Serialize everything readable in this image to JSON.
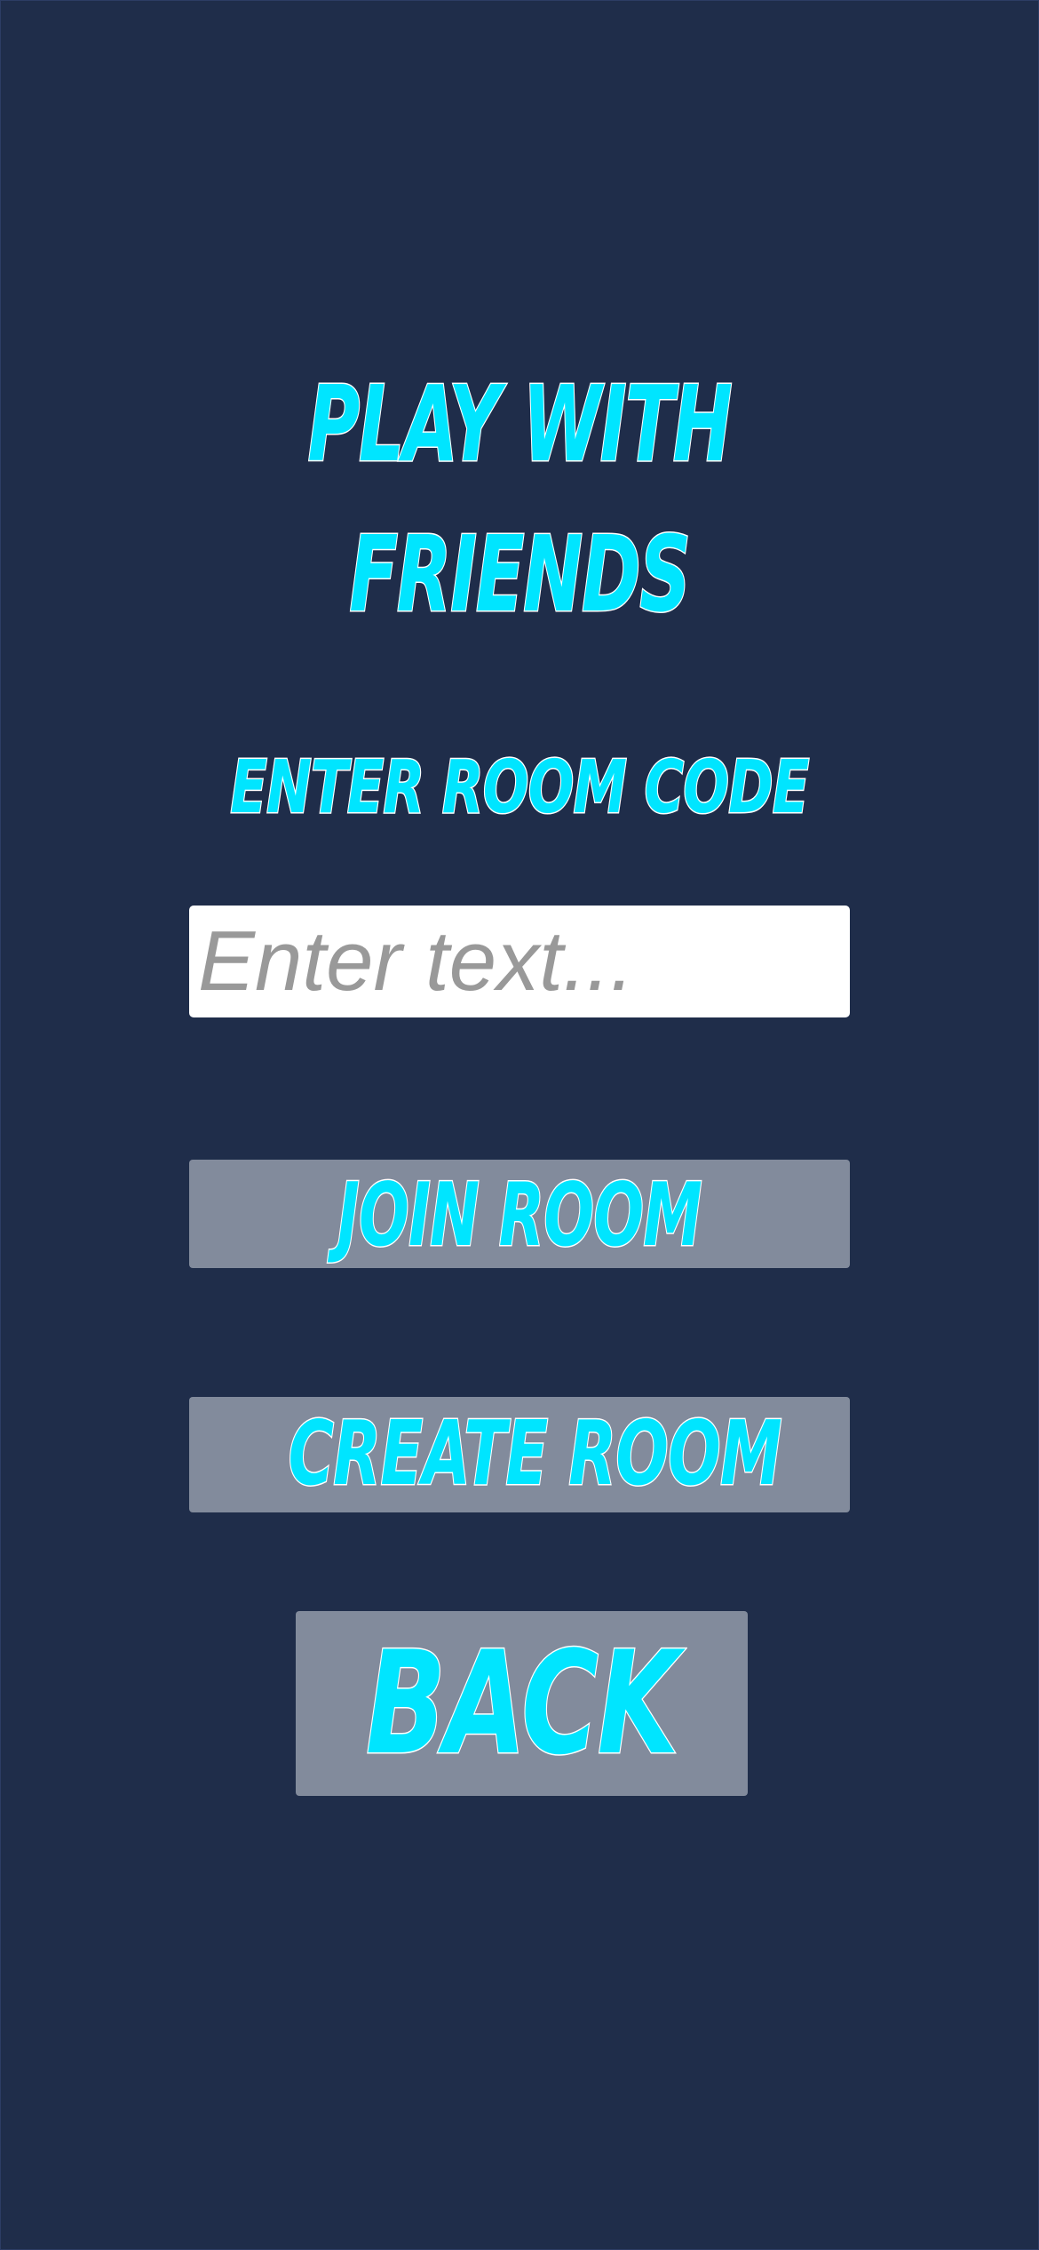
{
  "screen": {
    "title_line_1": "Play With",
    "title_line_2": "Friends",
    "subtitle": "Enter Room Code"
  },
  "room_code_input": {
    "value": "",
    "placeholder": "Enter text..."
  },
  "buttons": {
    "join_room": "Join Room",
    "create_room": "Create Room",
    "back": "Back"
  },
  "colors": {
    "background": "#1f2d4a",
    "accent_text": "#00e5ff",
    "text_outline": "#ffffff",
    "button_fill": "#828b9c",
    "input_fill": "#ffffff",
    "placeholder_text": "#999999"
  }
}
